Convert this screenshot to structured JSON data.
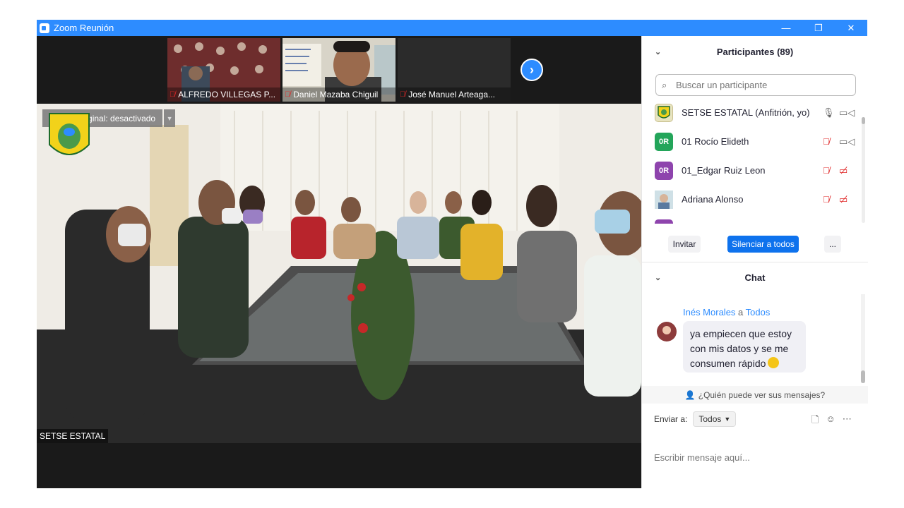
{
  "window": {
    "title": "Zoom Reunión",
    "controls": [
      "—",
      "❐",
      "✕"
    ]
  },
  "thumbnails": [
    {
      "name": "ALFREDO VILLEGAS P...",
      "muted": true
    },
    {
      "name": "Daniel Mazaba Chiguil",
      "muted": true
    },
    {
      "name": "José Manuel Arteaga...",
      "muted": true
    }
  ],
  "main_video": {
    "audio_label": "Sonido original: desactivado",
    "speaker_name": "SETSE ESTATAL"
  },
  "participants": {
    "header": "Participantes (89)",
    "search_placeholder": "Buscar un participante",
    "list": [
      {
        "avatar": "",
        "name": "SETSE ESTATAL (Anfitrión, yo)",
        "avatar_color": "#e8e4c0",
        "mic": "on",
        "cam": "on"
      },
      {
        "avatar": "0R",
        "name": "01 Rocío Elideth",
        "avatar_color": "#23a55a",
        "mic": "muted",
        "cam": "on"
      },
      {
        "avatar": "0R",
        "name": "01_Edgar Ruiz Leon",
        "avatar_color": "#8e44ad",
        "mic": "muted",
        "cam": "off"
      },
      {
        "avatar": "",
        "name": "Adriana Alonso",
        "avatar_color": "#9fb8a6",
        "mic": "muted",
        "cam": "off"
      }
    ],
    "buttons": {
      "invite": "Invitar",
      "mute_all": "Silenciar a todos",
      "more": "..."
    }
  },
  "chat": {
    "header": "Chat",
    "message": {
      "sender": "Inés Morales",
      "connector": " a ",
      "recipient": "Todos",
      "text": "ya empiecen que estoy con mis datos y se me consumen rápido"
    },
    "who_sees": "¿Quién puede ver sus mensajes?",
    "send_to_label": "Enviar a:",
    "send_to_value": "Todos",
    "input_placeholder": "Escribir mensaje aquí..."
  },
  "colors": {
    "brand": "#2d8cff",
    "mute_red": "#e02828"
  }
}
